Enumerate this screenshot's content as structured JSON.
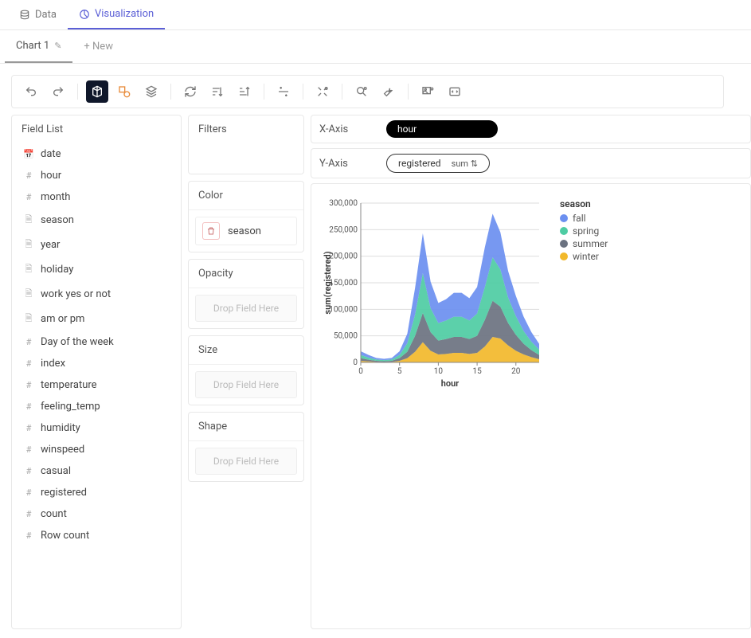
{
  "nav": {
    "data_tab": "Data",
    "viz_tab": "Visualization"
  },
  "chart_tabs": {
    "chart1": "Chart 1",
    "new": "+ New"
  },
  "panels": {
    "field_list_title": "Field List",
    "filters_title": "Filters",
    "color_title": "Color",
    "opacity_title": "Opacity",
    "size_title": "Size",
    "shape_title": "Shape",
    "drop_placeholder": "Drop Field Here"
  },
  "fields": [
    {
      "icon": "date",
      "label": "date"
    },
    {
      "icon": "hash",
      "label": "hour"
    },
    {
      "icon": "hash",
      "label": "month"
    },
    {
      "icon": "doc",
      "label": "season"
    },
    {
      "icon": "doc",
      "label": "year"
    },
    {
      "icon": "doc",
      "label": "holiday"
    },
    {
      "icon": "doc",
      "label": "work yes or not"
    },
    {
      "icon": "doc",
      "label": "am or pm"
    },
    {
      "icon": "hash",
      "label": "Day of the week"
    },
    {
      "icon": "hash",
      "label": "index"
    },
    {
      "icon": "hash",
      "label": "temperature"
    },
    {
      "icon": "hash",
      "label": "feeling_temp"
    },
    {
      "icon": "hash",
      "label": "humidity"
    },
    {
      "icon": "hash",
      "label": "winspeed"
    },
    {
      "icon": "hash",
      "label": "casual"
    },
    {
      "icon": "hash",
      "label": "registered"
    },
    {
      "icon": "hash",
      "label": "count"
    },
    {
      "icon": "hash",
      "label": "Row count"
    }
  ],
  "encodings": {
    "x_label": "X-Axis",
    "y_label": "Y-Axis",
    "x_field": "hour",
    "y_field": "registered",
    "y_agg": "sum",
    "color_field": "season"
  },
  "chart_data": {
    "type": "area",
    "stacked": true,
    "xlabel": "hour",
    "ylabel": "sum(registered)",
    "xlim": [
      0,
      23
    ],
    "ylim": [
      0,
      300000
    ],
    "x_ticks": [
      0,
      5,
      10,
      15,
      20
    ],
    "y_ticks": [
      0,
      50000,
      100000,
      150000,
      200000,
      250000,
      300000
    ],
    "x": [
      0,
      1,
      2,
      3,
      4,
      5,
      6,
      7,
      8,
      9,
      10,
      11,
      12,
      13,
      14,
      15,
      16,
      17,
      18,
      19,
      20,
      21,
      22,
      23
    ],
    "legend_title": "season",
    "series": [
      {
        "name": "winter",
        "color": "#f2b92b",
        "values": [
          3000,
          2000,
          1000,
          800,
          1000,
          3000,
          8000,
          20000,
          38000,
          22000,
          15000,
          16000,
          18000,
          18000,
          16000,
          18000,
          30000,
          48000,
          45000,
          32000,
          22000,
          15000,
          10000,
          6000
        ]
      },
      {
        "name": "summer",
        "color": "#6b7280",
        "values": [
          5000,
          3000,
          2000,
          1500,
          2000,
          5000,
          12000,
          30000,
          55000,
          35000,
          26000,
          28000,
          30000,
          30000,
          28000,
          32000,
          50000,
          68000,
          60000,
          42000,
          30000,
          20000,
          13000,
          8000
        ]
      },
      {
        "name": "spring",
        "color": "#4ecca3",
        "values": [
          6000,
          4000,
          2500,
          2000,
          2500,
          6000,
          16000,
          40000,
          75000,
          45000,
          33000,
          35000,
          38000,
          38000,
          35000,
          42000,
          62000,
          82000,
          70000,
          48000,
          35000,
          24000,
          16000,
          10000
        ]
      },
      {
        "name": "fall",
        "color": "#6b8ff0",
        "values": [
          7000,
          5000,
          3000,
          2500,
          3000,
          7000,
          18000,
          50000,
          75000,
          50000,
          38000,
          40000,
          45000,
          45000,
          42000,
          50000,
          75000,
          82000,
          70000,
          50000,
          38000,
          27000,
          18000,
          11000
        ]
      }
    ]
  }
}
